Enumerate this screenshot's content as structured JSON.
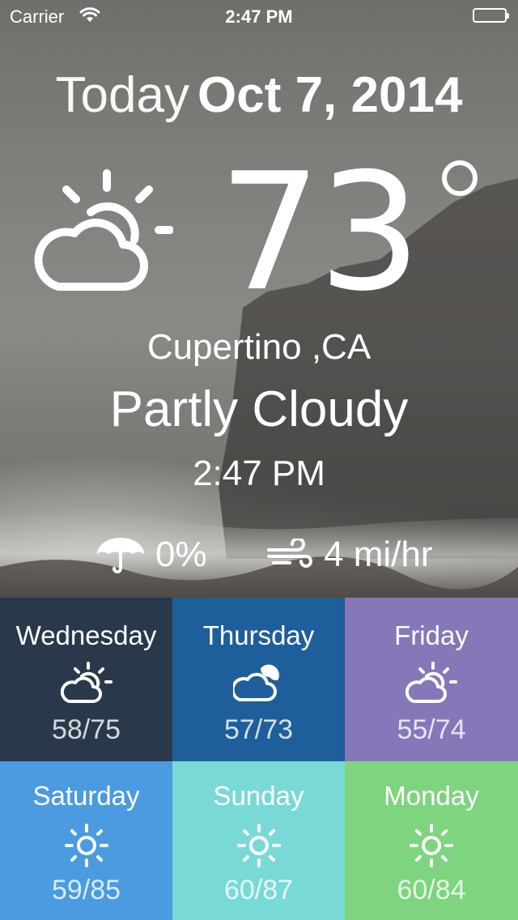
{
  "status_bar": {
    "carrier": "Carrier",
    "time": "2:47 PM"
  },
  "header": {
    "today_label": "Today",
    "date": "Oct 7, 2014"
  },
  "current": {
    "icon": "partly-cloudy-icon",
    "temperature": "73",
    "location": "Cupertino ,CA",
    "condition": "Partly Cloudy",
    "time": "2:47 PM",
    "precipitation_icon": "umbrella-icon",
    "precipitation": "0%",
    "wind_icon": "wind-icon",
    "wind": "4 mi/hr"
  },
  "forecast": [
    {
      "day": "Wednesday",
      "icon": "partly-cloudy-icon",
      "range": "58/75",
      "color": "#2a384b"
    },
    {
      "day": "Thursday",
      "icon": "cloudy-sun-icon",
      "range": "57/73",
      "color": "#1e5e9a"
    },
    {
      "day": "Friday",
      "icon": "partly-cloudy-icon",
      "range": "55/74",
      "color": "#8577b8"
    },
    {
      "day": "Saturday",
      "icon": "sun-icon",
      "range": "59/85",
      "color": "#4a9be0"
    },
    {
      "day": "Sunday",
      "icon": "sun-icon",
      "range": "60/87",
      "color": "#79d9d6"
    },
    {
      "day": "Monday",
      "icon": "sun-icon",
      "range": "60/84",
      "color": "#7ed47f"
    }
  ]
}
